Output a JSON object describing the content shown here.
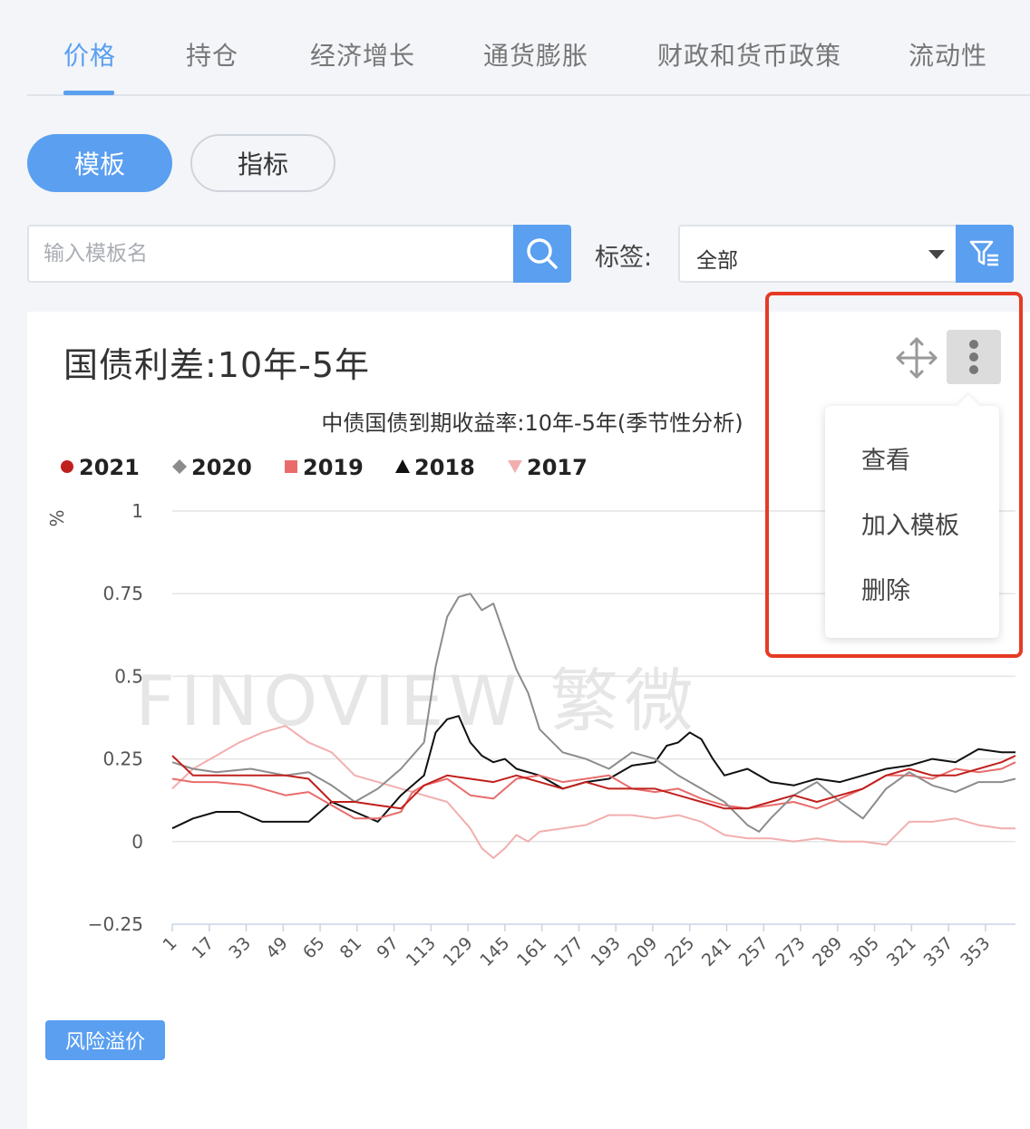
{
  "tabs": [
    "价格",
    "持仓",
    "经济增长",
    "通货膨胀",
    "财政和货币政策",
    "流动性"
  ],
  "active_tab_index": 0,
  "mode_buttons": {
    "template": "模板",
    "indicator": "指标"
  },
  "search": {
    "placeholder": "输入模板名",
    "value": ""
  },
  "tag_filter": {
    "label": "标签:",
    "selected": "全部"
  },
  "card": {
    "title": "国债利差:10年-5年",
    "badge": "风险溢价"
  },
  "menu": {
    "items": [
      "查看",
      "加入模板",
      "删除"
    ]
  },
  "watermark": "FINOVIEW 繁微",
  "colors": {
    "accent": "#5a9ff0",
    "highlight": "#e63a25"
  },
  "chart_data": {
    "type": "line",
    "title": "中债国债到期收益率:10年-5年(季节性分析)",
    "ylabel": "%",
    "xlabel": "",
    "ylim": [
      -0.25,
      1
    ],
    "yticks": [
      1,
      0.75,
      0.5,
      0.25,
      0,
      -0.25
    ],
    "ytick_labels": [
      "1",
      "0.75",
      "0.5",
      "0.25",
      "0",
      "−0.25"
    ],
    "xlim": [
      1,
      366
    ],
    "xticks": [
      1,
      17,
      33,
      49,
      65,
      81,
      97,
      113,
      129,
      145,
      161,
      177,
      193,
      209,
      225,
      241,
      257,
      273,
      289,
      305,
      321,
      337,
      353
    ],
    "grid": true,
    "legend_position": "top-left",
    "series": [
      {
        "name": "2021",
        "color": "#c0201d",
        "marker": "circle",
        "x": [
          1,
          10,
          20,
          35,
          50,
          60,
          70,
          80,
          90,
          100,
          110,
          120,
          130,
          140,
          150,
          160,
          170,
          180,
          190,
          200,
          210,
          220,
          230,
          240,
          250,
          260,
          270,
          280,
          290,
          300,
          310,
          320,
          330,
          340,
          350,
          360,
          366
        ],
        "y": [
          0.26,
          0.2,
          0.2,
          0.2,
          0.2,
          0.19,
          0.12,
          0.12,
          0.11,
          0.1,
          0.17,
          0.2,
          0.19,
          0.18,
          0.2,
          0.18,
          0.16,
          0.18,
          0.16,
          0.16,
          0.16,
          0.14,
          0.12,
          0.1,
          0.1,
          0.12,
          0.14,
          0.12,
          0.14,
          0.16,
          0.2,
          0.22,
          0.2,
          0.2,
          0.22,
          0.24,
          0.26
        ]
      },
      {
        "name": "2020",
        "color": "#8c8c8c",
        "marker": "diamond",
        "x": [
          1,
          10,
          20,
          35,
          50,
          60,
          70,
          80,
          90,
          100,
          110,
          115,
          120,
          125,
          130,
          135,
          140,
          145,
          150,
          155,
          160,
          170,
          180,
          190,
          200,
          210,
          220,
          230,
          240,
          250,
          255,
          260,
          270,
          280,
          290,
          300,
          310,
          320,
          330,
          340,
          350,
          360,
          366
        ],
        "y": [
          0.24,
          0.22,
          0.21,
          0.22,
          0.2,
          0.21,
          0.17,
          0.12,
          0.16,
          0.22,
          0.3,
          0.53,
          0.68,
          0.74,
          0.75,
          0.7,
          0.72,
          0.62,
          0.52,
          0.45,
          0.34,
          0.27,
          0.25,
          0.22,
          0.27,
          0.25,
          0.2,
          0.16,
          0.12,
          0.05,
          0.03,
          0.07,
          0.14,
          0.18,
          0.12,
          0.07,
          0.16,
          0.21,
          0.17,
          0.15,
          0.18,
          0.18,
          0.19
        ]
      },
      {
        "name": "2019",
        "color": "#e96c6c",
        "marker": "square",
        "x": [
          1,
          10,
          20,
          35,
          50,
          60,
          70,
          80,
          90,
          100,
          105,
          110,
          120,
          130,
          140,
          150,
          160,
          170,
          180,
          190,
          200,
          210,
          220,
          230,
          240,
          250,
          260,
          270,
          280,
          290,
          300,
          310,
          320,
          330,
          340,
          350,
          360,
          366
        ],
        "y": [
          0.19,
          0.18,
          0.18,
          0.17,
          0.14,
          0.15,
          0.11,
          0.07,
          0.07,
          0.09,
          0.15,
          0.17,
          0.19,
          0.14,
          0.13,
          0.19,
          0.2,
          0.18,
          0.19,
          0.2,
          0.16,
          0.15,
          0.16,
          0.13,
          0.11,
          0.1,
          0.11,
          0.12,
          0.1,
          0.13,
          0.16,
          0.2,
          0.2,
          0.19,
          0.22,
          0.21,
          0.22,
          0.24
        ]
      },
      {
        "name": "2018",
        "color": "#111111",
        "marker": "triangle-up",
        "x": [
          1,
          10,
          20,
          30,
          40,
          50,
          60,
          70,
          80,
          90,
          100,
          110,
          115,
          120,
          125,
          130,
          135,
          140,
          145,
          150,
          160,
          170,
          180,
          190,
          200,
          210,
          215,
          220,
          225,
          230,
          235,
          240,
          250,
          260,
          270,
          280,
          290,
          300,
          310,
          320,
          330,
          340,
          350,
          360,
          366
        ],
        "y": [
          0.04,
          0.07,
          0.09,
          0.09,
          0.06,
          0.06,
          0.06,
          0.12,
          0.09,
          0.06,
          0.14,
          0.2,
          0.33,
          0.37,
          0.38,
          0.3,
          0.26,
          0.24,
          0.25,
          0.22,
          0.2,
          0.16,
          0.18,
          0.19,
          0.23,
          0.24,
          0.29,
          0.3,
          0.33,
          0.31,
          0.25,
          0.2,
          0.22,
          0.18,
          0.17,
          0.19,
          0.18,
          0.2,
          0.22,
          0.23,
          0.25,
          0.24,
          0.28,
          0.27,
          0.27
        ]
      },
      {
        "name": "2017",
        "color": "#f2aeae",
        "marker": "triangle-down",
        "x": [
          1,
          10,
          20,
          30,
          40,
          50,
          60,
          70,
          80,
          90,
          100,
          110,
          120,
          130,
          135,
          140,
          145,
          150,
          155,
          160,
          170,
          180,
          190,
          200,
          210,
          220,
          230,
          240,
          250,
          260,
          270,
          280,
          290,
          300,
          310,
          320,
          330,
          340,
          350,
          360,
          366
        ],
        "y": [
          0.16,
          0.22,
          0.26,
          0.3,
          0.33,
          0.35,
          0.3,
          0.27,
          0.2,
          0.18,
          0.16,
          0.14,
          0.12,
          0.04,
          -0.02,
          -0.05,
          -0.02,
          0.02,
          0.0,
          0.03,
          0.04,
          0.05,
          0.08,
          0.08,
          0.07,
          0.08,
          0.06,
          0.02,
          0.01,
          0.01,
          0.0,
          0.01,
          0.0,
          0.0,
          -0.01,
          0.06,
          0.06,
          0.07,
          0.05,
          0.04,
          0.04
        ]
      }
    ]
  }
}
